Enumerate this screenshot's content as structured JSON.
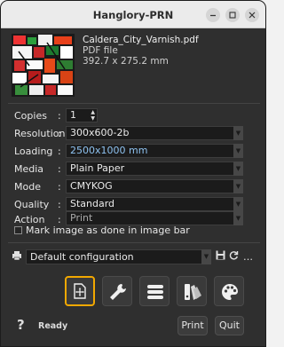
{
  "window": {
    "title": "Hanglory-PRN"
  },
  "file": {
    "name": "Caldera_City_Varnish.pdf",
    "type": "PDF file",
    "size": "392.7 x 275.2 mm"
  },
  "settings": {
    "copies": {
      "label": "Copies",
      "value": "1"
    },
    "resolution": {
      "label": "Resolution",
      "value": "300x600-2b"
    },
    "loading": {
      "label": "Loading",
      "value": "2500x1000 mm"
    },
    "media": {
      "label": "Media",
      "value": "Plain Paper"
    },
    "mode": {
      "label": "Mode",
      "value": "CMYKOG"
    },
    "quality": {
      "label": "Quality",
      "value": "Standard"
    },
    "action": {
      "label": "Action",
      "value": "Print"
    }
  },
  "checkbox": {
    "label": "Mark image as done in image bar",
    "checked": false
  },
  "configuration": {
    "value": "Default configuration"
  },
  "toolbar": {
    "buttons": [
      "position-icon",
      "wrench-icon",
      "list-icon",
      "swatch-icon",
      "palette-icon"
    ],
    "active": "position-icon"
  },
  "footer": {
    "help": "?",
    "status": "Ready",
    "print_label": "Print",
    "quit_label": "Quit"
  },
  "colors": {
    "accent": "#f2a800",
    "link_value": "#8ec2f0"
  }
}
